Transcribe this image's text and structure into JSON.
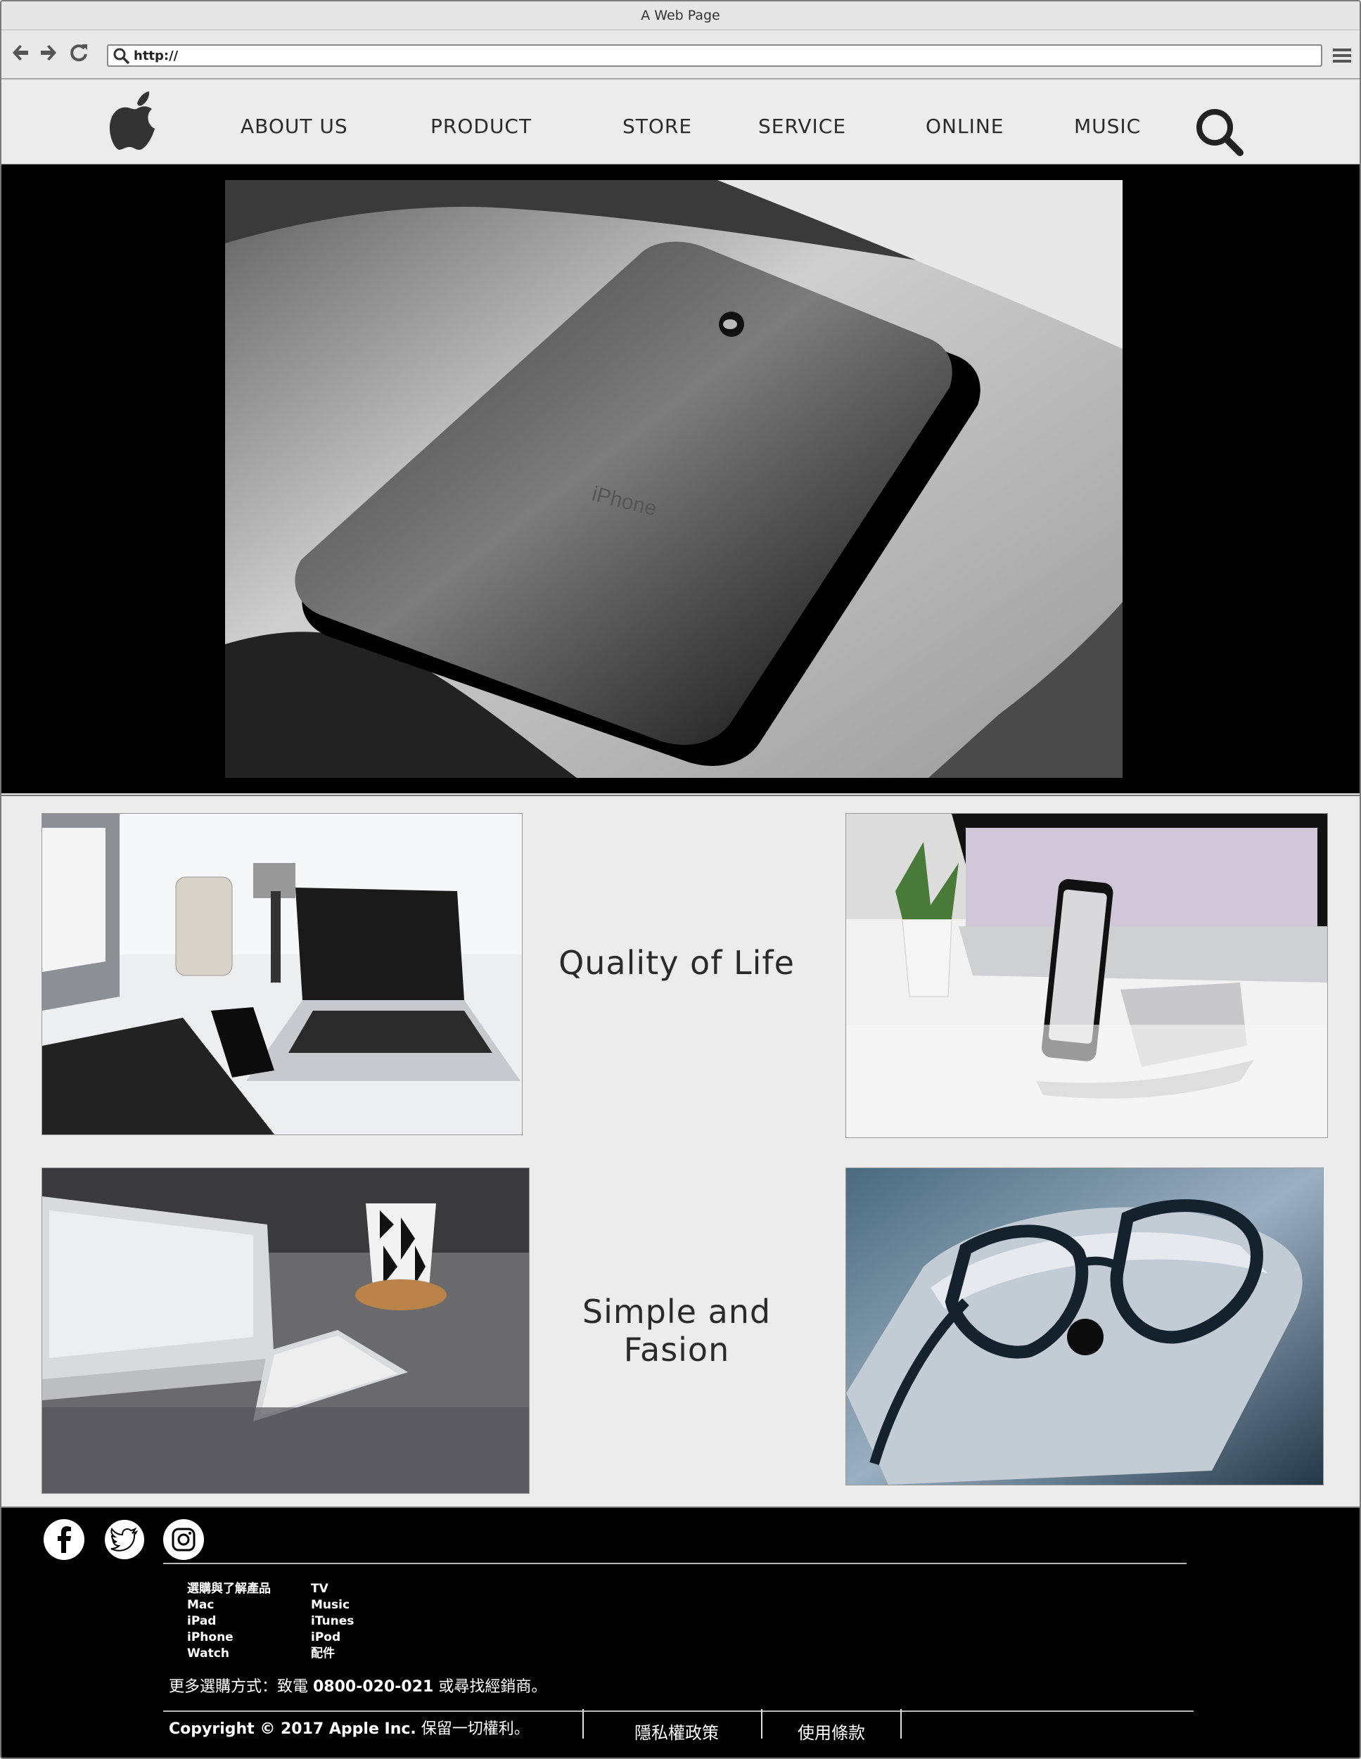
{
  "window": {
    "title": "A Web Page"
  },
  "browser": {
    "url_value": "http://",
    "back_icon": "arrow-left-icon",
    "forward_icon": "arrow-right-icon",
    "reload_icon": "refresh-icon",
    "menu_icon": "hamburger-menu-icon"
  },
  "header": {
    "logo_icon": "apple-logo-icon",
    "nav": [
      "ABOUT US",
      "PRODUCT",
      "STORE",
      "SERVICE",
      "ONLINE",
      "MUSIC"
    ],
    "search_icon": "magnifier-icon"
  },
  "hero": {
    "image": "black iPhone on paper, greyscale photo"
  },
  "sections": {
    "row1_tagline": "Quality of Life",
    "row2_tagline": "Simple and Fasion"
  },
  "footer": {
    "social": [
      "facebook-icon",
      "twitter-icon",
      "instagram-icon"
    ],
    "col1": [
      "選購與了解產品",
      "Mac",
      "iPad",
      "iPhone",
      "Watch"
    ],
    "col2": [
      "TV",
      "Music",
      "iTunes",
      "iPod",
      "配件"
    ],
    "contact_prefix": "更多選購方式：致電 ",
    "contact_phone": "0800-020-021",
    "contact_suffix": " 或尋找經銷商。",
    "copyright_en": "Copyright © 2017 Apple Inc.",
    "copyright_zh": " 保留一切權利。",
    "privacy": "隱私權政策",
    "terms": "使用條款"
  },
  "colors": {
    "chrome": "#e9e9e9",
    "page_bg": "#ececec",
    "hero_bg": "#000000",
    "footer_bg": "#000000"
  }
}
